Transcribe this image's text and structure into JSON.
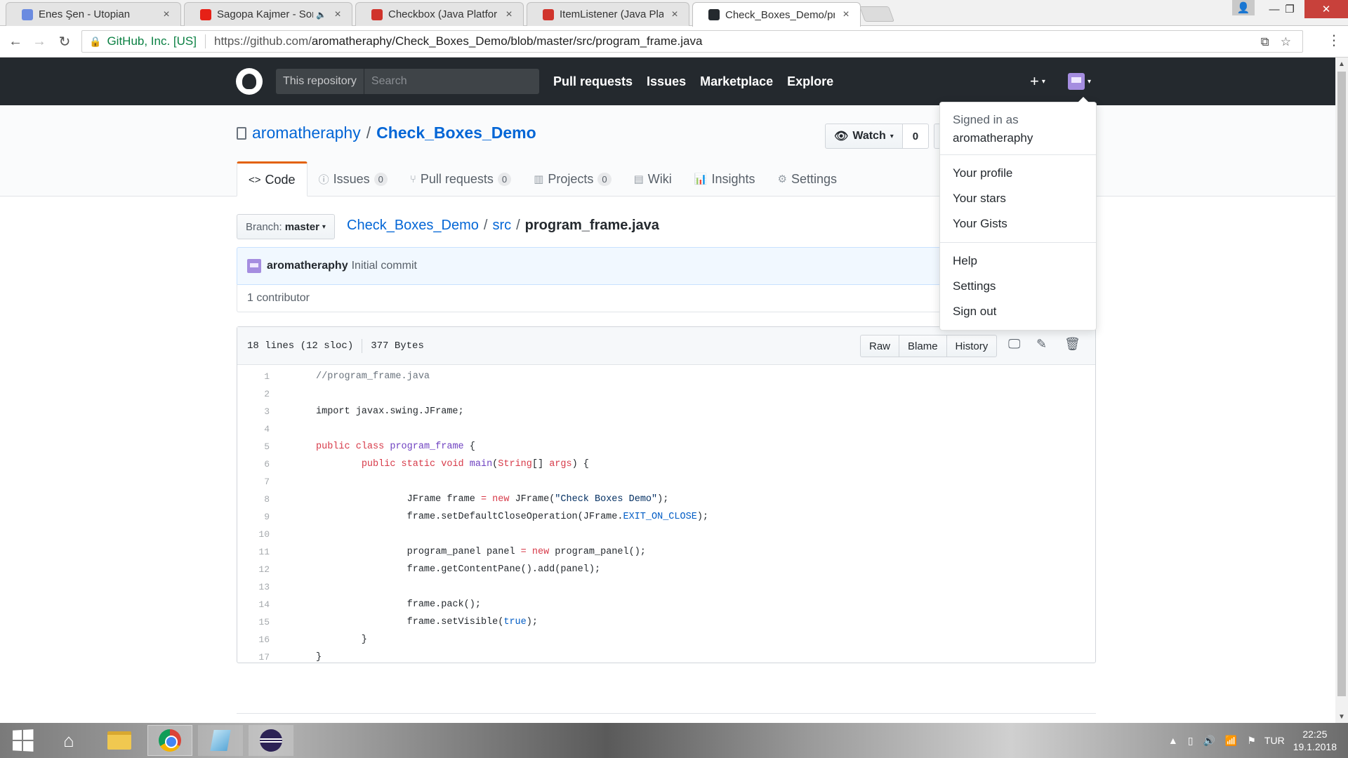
{
  "browser": {
    "tabs": [
      {
        "title": "Enes Şen - Utopian",
        "favicon_color": "#6b8be0",
        "active": false
      },
      {
        "title": "Sagopa Kajmer - Soru",
        "favicon_color": "#e62117",
        "active": false,
        "muted_icon": "🔈"
      },
      {
        "title": "Checkbox (Java Platform",
        "favicon_color": "#d0342c",
        "active": false
      },
      {
        "title": "ItemListener (Java Platfor",
        "favicon_color": "#d0342c",
        "active": false
      },
      {
        "title": "Check_Boxes_Demo/pro",
        "favicon_color": "#24292e",
        "active": true
      }
    ],
    "tab_close": "×",
    "window_controls": {
      "user": "👤",
      "minimize": "—",
      "maximize": "❐",
      "close": "✕"
    },
    "nav": {
      "back": "←",
      "forward": "→",
      "reload": "↻"
    },
    "address": {
      "lock": "🔒",
      "secure_label": "GitHub, Inc. [US]",
      "url_prefix": "https://github.com/",
      "url_path": "aromatheraphy/Check_Boxes_Demo/blob/master/src/program_frame.java"
    },
    "omni_icons": {
      "translate": "⧉",
      "star": "☆",
      "menu": "⋮"
    }
  },
  "github": {
    "header": {
      "search_scope": "This repository",
      "search_placeholder": "Search",
      "nav": [
        "Pull requests",
        "Issues",
        "Marketplace",
        "Explore"
      ],
      "plus": "+",
      "caret": "▾"
    },
    "repo": {
      "owner": "aromatheraphy",
      "separator": "/",
      "name": "Check_Boxes_Demo",
      "watch_label": "Watch",
      "watch_icon": "👁",
      "watch_caret": "▾",
      "watch_count": "0"
    },
    "tabs": [
      {
        "icon": "<>",
        "label": "Code",
        "count": null,
        "selected": true
      },
      {
        "icon": "ⓘ",
        "label": "Issues",
        "count": "0",
        "selected": false
      },
      {
        "icon": "⑂",
        "label": "Pull requests",
        "count": "0",
        "selected": false
      },
      {
        "icon": "▥",
        "label": "Projects",
        "count": "0",
        "selected": false
      },
      {
        "icon": "▤",
        "label": "Wiki",
        "count": null,
        "selected": false
      },
      {
        "icon": "📊",
        "label": "Insights",
        "count": null,
        "selected": false
      },
      {
        "icon": "⚙",
        "label": "Settings",
        "count": null,
        "selected": false
      }
    ],
    "branch": {
      "label": "Branch:",
      "value": "master",
      "caret": "▾"
    },
    "breadcrumb": {
      "root": "Check_Boxes_Demo",
      "dir": "src",
      "file": "program_frame.java",
      "sep": "/"
    },
    "commit": {
      "author": "aromatheraphy",
      "message": "Initial commit"
    },
    "contributors": "1 contributor",
    "file": {
      "lines_info": "18 lines (12 sloc)",
      "size": "377 Bytes",
      "actions": [
        "Raw",
        "Blame",
        "History"
      ],
      "icons": {
        "desktop": "🖵",
        "edit": "✎",
        "delete": "🗑"
      }
    },
    "code_lines": [
      [
        {
          "t": "//program_frame.java",
          "c": "cm"
        }
      ],
      [],
      [
        {
          "t": "import javax.swing.JFrame;",
          "c": ""
        }
      ],
      [],
      [
        {
          "t": "public",
          "c": "kw"
        },
        {
          "t": " ",
          "c": ""
        },
        {
          "t": "class",
          "c": "kw"
        },
        {
          "t": " ",
          "c": ""
        },
        {
          "t": "program_frame",
          "c": "fn"
        },
        {
          "t": " {",
          "c": ""
        }
      ],
      [
        {
          "t": "        ",
          "c": ""
        },
        {
          "t": "public",
          "c": "kw"
        },
        {
          "t": " ",
          "c": ""
        },
        {
          "t": "static",
          "c": "kw"
        },
        {
          "t": " ",
          "c": ""
        },
        {
          "t": "void",
          "c": "kw"
        },
        {
          "t": " ",
          "c": ""
        },
        {
          "t": "main",
          "c": "fn"
        },
        {
          "t": "(",
          "c": ""
        },
        {
          "t": "String",
          "c": "kw"
        },
        {
          "t": "[] ",
          "c": ""
        },
        {
          "t": "args",
          "c": "kw"
        },
        {
          "t": ") {",
          "c": ""
        }
      ],
      [],
      [
        {
          "t": "                JFrame frame ",
          "c": ""
        },
        {
          "t": "=",
          "c": "kw"
        },
        {
          "t": " ",
          "c": ""
        },
        {
          "t": "new",
          "c": "kw"
        },
        {
          "t": " JFrame(",
          "c": ""
        },
        {
          "t": "\"Check Boxes Demo\"",
          "c": "str"
        },
        {
          "t": ");",
          "c": ""
        }
      ],
      [
        {
          "t": "                frame.setDefaultCloseOperation(JFrame.",
          "c": ""
        },
        {
          "t": "EXIT_ON_CLOSE",
          "c": "cst"
        },
        {
          "t": ");",
          "c": ""
        }
      ],
      [],
      [
        {
          "t": "                program_panel panel ",
          "c": ""
        },
        {
          "t": "=",
          "c": "kw"
        },
        {
          "t": " ",
          "c": ""
        },
        {
          "t": "new",
          "c": "kw"
        },
        {
          "t": " program_panel();",
          "c": ""
        }
      ],
      [
        {
          "t": "                frame.getContentPane().add(panel);",
          "c": ""
        }
      ],
      [],
      [
        {
          "t": "                frame.pack();",
          "c": ""
        }
      ],
      [
        {
          "t": "                frame.setVisible(",
          "c": ""
        },
        {
          "t": "true",
          "c": "cst"
        },
        {
          "t": ");",
          "c": ""
        }
      ],
      [
        {
          "t": "        }",
          "c": ""
        }
      ],
      [
        {
          "t": "}",
          "c": ""
        }
      ]
    ],
    "dropdown": {
      "signed_in_as": "Signed in as",
      "username": "aromatheraphy",
      "groups": [
        [
          "Your profile",
          "Your stars",
          "Your Gists"
        ],
        [
          "Help",
          "Settings",
          "Sign out"
        ]
      ]
    }
  },
  "taskbar": {
    "home": "⌂",
    "tray_icons": [
      "▲",
      "▯",
      "🔊",
      "📶",
      "⚑"
    ],
    "language": "TUR",
    "time": "22:25",
    "date": "19.1.2018"
  }
}
